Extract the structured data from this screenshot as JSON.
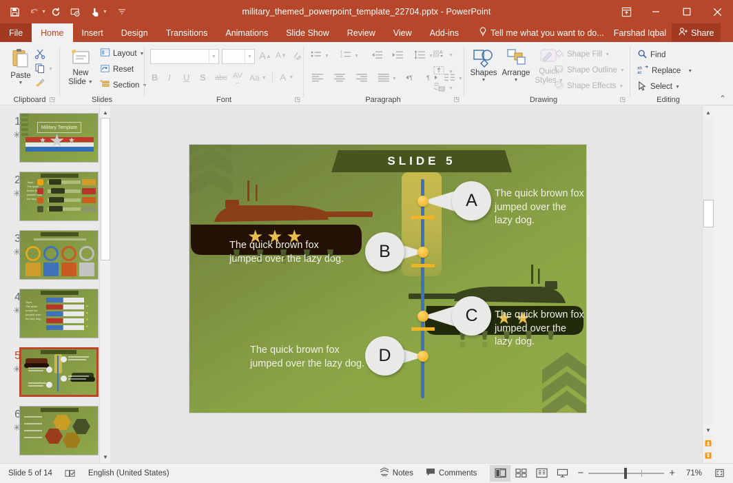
{
  "window": {
    "title": "military_themed_powerpoint_template_22704.pptx - PowerPoint",
    "quick_access": [
      {
        "name": "save",
        "icon": "save-icon"
      },
      {
        "name": "undo",
        "icon": "undo-icon"
      },
      {
        "name": "redo",
        "icon": "redo-icon"
      },
      {
        "name": "start-from-beginning",
        "icon": "slideshow-icon"
      },
      {
        "name": "touch-mouse-mode",
        "icon": "touch-mode-icon"
      },
      {
        "name": "customize-quick-access-toolbar",
        "icon": "chevron-down-icon"
      }
    ],
    "controls": {
      "ribbon_display": "ribbon-display-options-icon",
      "minimize": "–",
      "restore": "❐",
      "close": "✕"
    }
  },
  "tabs": [
    {
      "label": "File",
      "state": "file"
    },
    {
      "label": "Home",
      "state": "active"
    },
    {
      "label": "Insert",
      "state": "normal"
    },
    {
      "label": "Design",
      "state": "normal"
    },
    {
      "label": "Transitions",
      "state": "normal"
    },
    {
      "label": "Animations",
      "state": "normal"
    },
    {
      "label": "Slide Show",
      "state": "normal"
    },
    {
      "label": "Review",
      "state": "normal"
    },
    {
      "label": "View",
      "state": "normal"
    },
    {
      "label": "Add-ins",
      "state": "normal"
    }
  ],
  "tellme": {
    "label": "Tell me what you want to do...",
    "icon": "lightbulb-icon"
  },
  "account": {
    "user": "Farshad Iqbal",
    "share_label": "Share",
    "share_icon": "share-person-icon"
  },
  "ribbon": {
    "groups": [
      {
        "name": "Clipboard",
        "label": "Clipboard"
      },
      {
        "name": "Slides",
        "label": "Slides"
      },
      {
        "name": "Font",
        "label": "Font"
      },
      {
        "name": "Paragraph",
        "label": "Paragraph"
      },
      {
        "name": "Drawing",
        "label": "Drawing"
      },
      {
        "name": "Editing",
        "label": "Editing"
      }
    ],
    "clipboard": {
      "paste": "Paste",
      "cut": "cut-icon",
      "copy": "copy-icon",
      "format_painter": "format-painter-icon"
    },
    "slides": {
      "new_slide": "New\nSlide",
      "new_slide_line1": "New",
      "new_slide_line2": "Slide",
      "layout": "Layout",
      "reset": "Reset",
      "section": "Section"
    },
    "font": {
      "font_name_value": "",
      "font_size_value": "",
      "increase_size": "A",
      "decrease_size": "A",
      "clear_formatting": "clear-formatting-icon",
      "bold": "B",
      "italic": "I",
      "underline": "U",
      "shadow": "S",
      "strikethrough": "abc",
      "character_spacing": "AV",
      "change_case": "Aa",
      "font_color": "A"
    },
    "paragraph": {
      "bullets": "bullets-icon",
      "numbering": "numbering-icon",
      "decrease_indent": "decrease-indent-icon",
      "increase_indent": "increase-indent-icon",
      "line_spacing": "line-spacing-icon",
      "align_left": "align-left-icon",
      "align_center": "align-center-icon",
      "align_right": "align-right-icon",
      "justify": "justify-icon",
      "ltr": "text-direction-ltr-icon",
      "rtl": "text-direction-rtl-icon",
      "columns": "columns-icon",
      "text_direction": "text-direction-icon",
      "align_text": "align-text-icon",
      "smartart": "convert-to-smartart-icon"
    },
    "drawing": {
      "shapes": "Shapes",
      "arrange": "Arrange",
      "quick_styles_line1": "Quick",
      "quick_styles_line2": "Styles",
      "shape_fill": "Shape Fill",
      "shape_outline": "Shape Outline",
      "shape_effects": "Shape Effects"
    },
    "editing": {
      "find": "Find",
      "replace": "Replace",
      "select": "Select"
    },
    "collapse_ribbon": "collapse-ribbon-icon"
  },
  "thumbnails": [
    {
      "number": "1",
      "star": "☀"
    },
    {
      "number": "2",
      "star": "☀"
    },
    {
      "number": "3",
      "star": "☀"
    },
    {
      "number": "4",
      "star": "☀"
    },
    {
      "number": "5",
      "star": "☀"
    },
    {
      "number": "6",
      "star": "☀"
    }
  ],
  "slide": {
    "title": "SLIDE 5",
    "callouts": [
      {
        "letter": "A",
        "text_line1": "The quick brown fox",
        "text_line2": "jumped over the lazy dog."
      },
      {
        "letter": "B",
        "text_line1": "The quick brown fox",
        "text_line2": "jumped over the lazy dog."
      },
      {
        "letter": "C",
        "text_line1": "The quick brown fox",
        "text_line2": "jumped over the lazy dog."
      },
      {
        "letter": "D",
        "text_line1": "The quick brown fox",
        "text_line2": "jumped over the lazy dog."
      }
    ],
    "colors": {
      "background_green": "#8aa143",
      "banner_dark": "#46541f",
      "timeline_blue": "#3f72b8",
      "accent_yellow": "#f0b323",
      "callout_gray": "#e9e9e7",
      "tank_left": "#8f3d14",
      "tank_right": "#3e4a1e"
    },
    "tank_rank_stars": "★★★"
  },
  "statusbar": {
    "slide_count": "Slide 5 of 14",
    "spellcheck_icon": "spellcheck-icon",
    "language": "English (United States)",
    "notes": "Notes",
    "notes_icon": "notes-icon",
    "comments": "Comments",
    "comments_icon": "comments-icon",
    "views": [
      {
        "name": "normal-view",
        "icon": "normal-view-icon",
        "active": true
      },
      {
        "name": "slide-sorter-view",
        "icon": "slide-sorter-icon",
        "active": false
      },
      {
        "name": "reading-view",
        "icon": "reading-view-icon",
        "active": false
      },
      {
        "name": "slide-show-view",
        "icon": "slideshow-view-icon",
        "active": false
      }
    ],
    "zoom_out": "−",
    "zoom_in": "+",
    "zoom_level": "71%",
    "fit_slide_icon": "fit-to-window-icon"
  }
}
